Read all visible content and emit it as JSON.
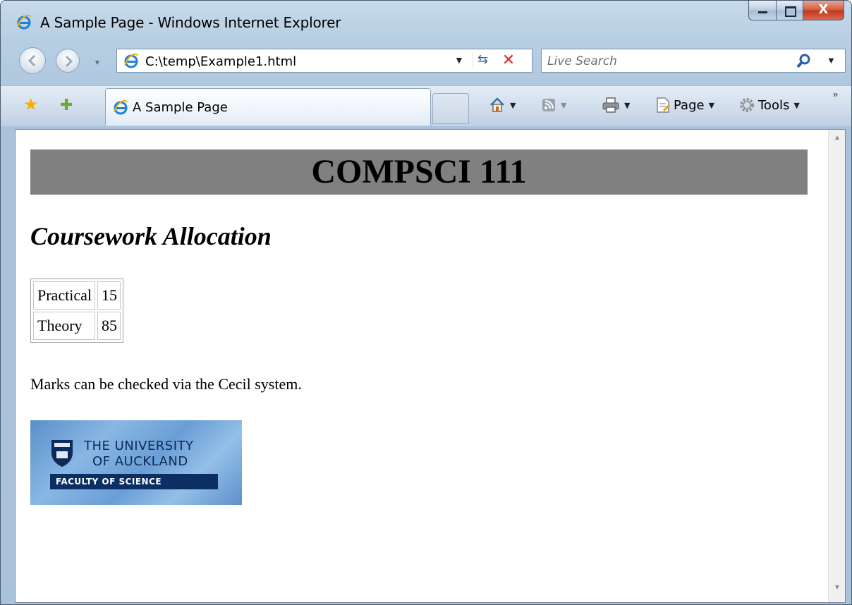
{
  "window": {
    "title": "A Sample Page - Windows Internet Explorer",
    "close_glyph": "X"
  },
  "nav": {
    "address": "C:\\temp\\Example1.html",
    "search_placeholder": "Live Search"
  },
  "tabs": [
    {
      "label": "A Sample Page",
      "active": true
    }
  ],
  "command_bar": {
    "page_label": "Page",
    "tools_label": "Tools"
  },
  "page": {
    "heading": "COMPSCI 111",
    "subheading": "Coursework Allocation",
    "table": [
      {
        "label": "Practical",
        "value": "15"
      },
      {
        "label": "Theory",
        "value": "85"
      }
    ],
    "paragraph": "Marks can be checked via the Cecil system.",
    "logo": {
      "line1": "THE UNIVERSITY",
      "line2": "OF AUCKLAND",
      "line3": "FACULTY OF SCIENCE"
    }
  },
  "icons": [
    "ie-icon",
    "back-icon",
    "forward-icon",
    "refresh-icon",
    "stop-icon",
    "search-icon",
    "favorites-star-icon",
    "add-favorites-icon",
    "home-icon",
    "feeds-icon",
    "print-icon",
    "page-icon",
    "tools-gear-icon"
  ],
  "colors": {
    "banner_background": "#808080",
    "frame": "#a9c3dc",
    "stop_red": "#d62a2a"
  }
}
